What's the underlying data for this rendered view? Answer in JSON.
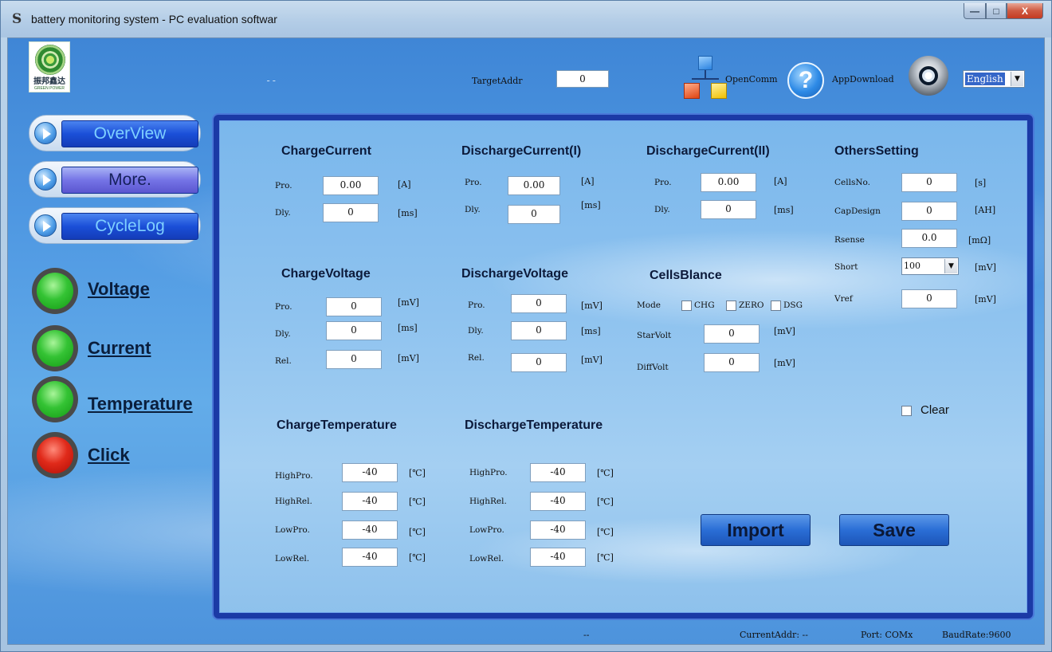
{
  "window": {
    "title": "battery monitoring system - PC evaluation softwar",
    "app_icon": "S",
    "min_glyph": "—",
    "max_glyph": "□",
    "close_glyph": "X"
  },
  "header": {
    "logo_text": "振邦鑫达",
    "logo_sub": "GREEN POWER",
    "dashes": "--",
    "target_label": "TargetAddr",
    "target_value": "0",
    "openc_label": "OpenComm",
    "help_glyph": "?",
    "help_label": "AppDownload",
    "language": "English",
    "dropdown_glyph": "▼"
  },
  "nav": {
    "overview": "OverView",
    "more": "More.",
    "cyclelog": "CycleLog"
  },
  "lights": [
    {
      "label": "Voltage",
      "color": "green"
    },
    {
      "label": "Current",
      "color": "green"
    },
    {
      "label": "Temperature",
      "color": "green"
    },
    {
      "label": "Click",
      "color": "red"
    }
  ],
  "charge_current": {
    "title": "ChargeCurrent",
    "pro_label": "Pro.",
    "pro_value": "0.00",
    "pro_unit": "[A]",
    "dly_label": "Dly.",
    "dly_value": "0",
    "dly_unit": "[ms]"
  },
  "discharge_current_1": {
    "title": "DischargeCurrent(I)",
    "pro_label": "Pro.",
    "pro_value": "0.00",
    "pro_unit": "[A]",
    "dly_label": "Dly.",
    "dly_value": "0",
    "dly_unit": "[ms]"
  },
  "discharge_current_2": {
    "title": "DischargeCurrent(II)",
    "pro_label": "Pro.",
    "pro_value": "0.00",
    "pro_unit": "[A]",
    "dly_label": "Dly.",
    "dly_value": "0",
    "dly_unit": "[ms]"
  },
  "others": {
    "title": "OthersSetting",
    "cells_label": "CellsNo.",
    "cells_value": "0",
    "cells_unit": "[s]",
    "cap_label": "CapDesign",
    "cap_value": "0",
    "cap_unit": "[AH]",
    "rsense_label": "Rsense",
    "rsense_value": "0.0",
    "rsense_unit": "[mΩ]",
    "short_label": "Short",
    "short_value": "100",
    "short_unit": "[mV]",
    "vref_label": "Vref",
    "vref_value": "0",
    "vref_unit": "[mV]"
  },
  "charge_voltage": {
    "title": "ChargeVoltage",
    "pro_label": "Pro.",
    "pro_value": "0",
    "pro_unit": "[mV]",
    "dly_label": "Dly.",
    "dly_value": "0",
    "dly_unit": "[ms]",
    "rel_label": "Rel.",
    "rel_value": "0",
    "rel_unit": "[mV]"
  },
  "discharge_voltage": {
    "title": "DischargeVoltage",
    "pro_label": "Pro.",
    "pro_value": "0",
    "pro_unit": "[mV]",
    "dly_label": "Dly.",
    "dly_value": "0",
    "dly_unit": "[ms]",
    "rel_label": "Rel.",
    "rel_value": "0",
    "rel_unit": "[mV]"
  },
  "cells_balance": {
    "title": "CellsBlance",
    "mode_label": "Mode",
    "chg_label": "CHG",
    "chg_checked": false,
    "zero_label": "ZERO",
    "zero_checked": false,
    "dsg_label": "DSG",
    "dsg_checked": false,
    "star_label": "StarVolt",
    "star_value": "0",
    "star_unit": "[mV]",
    "diff_label": "DiffVolt",
    "diff_value": "0",
    "diff_unit": "[mV]"
  },
  "clear": {
    "label": "Clear",
    "checked": false
  },
  "charge_temp": {
    "title": "ChargeTemperature",
    "hp_label": "HighPro.",
    "hp_value": "-40",
    "hp_unit": "[℃]",
    "hr_label": "HighRel.",
    "hr_value": "-40",
    "hr_unit": "[℃]",
    "lp_label": "LowPro.",
    "lp_value": "-40",
    "lp_unit": "[℃]",
    "lr_label": "LowRel.",
    "lr_value": "-40",
    "lr_unit": "[℃]"
  },
  "discharge_temp": {
    "title": "DischargeTemperature",
    "hp_label": "HighPro.",
    "hp_value": "-40",
    "hp_unit": "[℃]",
    "hr_label": "HighRel.",
    "hr_value": "-40",
    "hr_unit": "[℃]",
    "lp_label": "LowPro.",
    "lp_value": "-40",
    "lp_unit": "[℃]",
    "lr_label": "LowRel.",
    "lr_value": "-40",
    "lr_unit": "[℃]"
  },
  "buttons": {
    "import": "Import",
    "save": "Save"
  },
  "statusbar": {
    "dashes": "--",
    "current_addr": "CurrentAddr: --",
    "port": "Port: COMx",
    "baud": "BaudRate:9600"
  }
}
